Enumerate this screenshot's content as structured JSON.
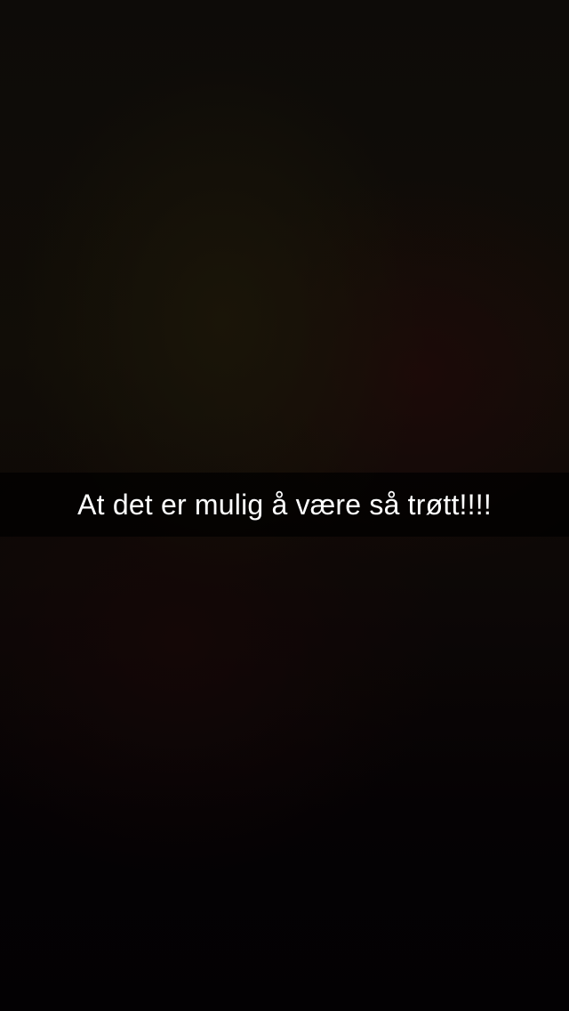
{
  "snap": {
    "caption": "At det er mulig å være så trøtt!!!!"
  },
  "colors": {
    "caption_text": "#ffffff",
    "caption_bar": "#000000",
    "background_dark": "#050203"
  }
}
